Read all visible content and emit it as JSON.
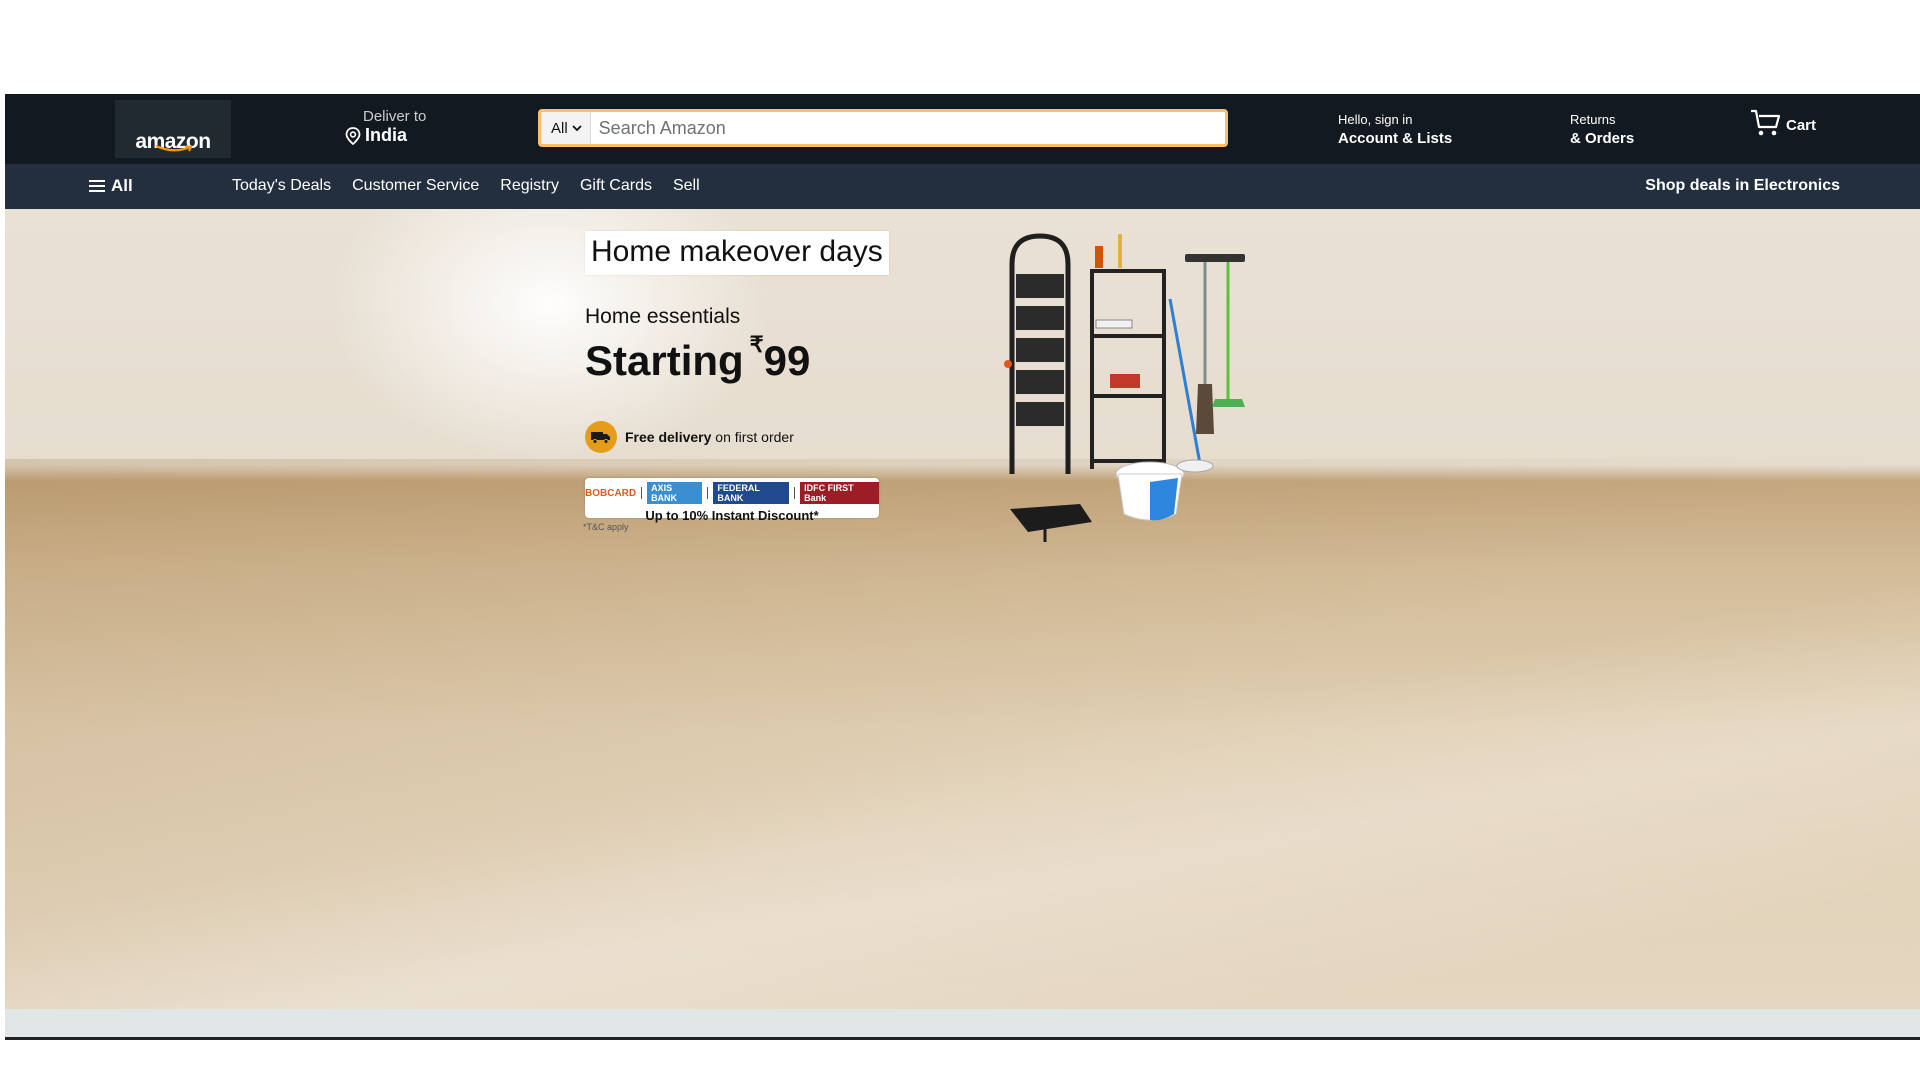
{
  "navbar": {
    "logo_text": "amazon",
    "deliver_label": "Deliver to",
    "deliver_location": "India",
    "search": {
      "category": "All",
      "placeholder": "Search Amazon"
    },
    "account_greeting": "Hello, sign in",
    "account_label": "Account & Lists",
    "returns_label": "Returns",
    "orders_label": "& Orders",
    "cart_label": "Cart"
  },
  "subnav": {
    "all_label": "All",
    "links": [
      "Today's Deals",
      "Customer Service",
      "Registry",
      "Gift Cards",
      "Sell"
    ],
    "promo": "Shop deals in Electronics"
  },
  "hero": {
    "badge": "Home makeover days",
    "subtitle": "Home essentials",
    "price_prefix": "Starting",
    "currency": "₹",
    "price": "99",
    "delivery_bold": "Free delivery",
    "delivery_rest": " on first order",
    "banks": [
      "BOBCARD",
      "AXIS BANK",
      "FEDERAL BANK",
      "IDFC FIRST Bank"
    ],
    "discount": "Up to 10% Instant Discount*",
    "terms": "*T&C apply"
  },
  "colors": {
    "navbar_bg": "#131921",
    "subnav_bg": "#232f3e",
    "search_border": "#febd69",
    "delivery_icon": "#e59c1a"
  },
  "icons": [
    "location-pin-icon",
    "chevron-down-icon",
    "cart-icon",
    "hamburger-menu-icon",
    "delivery-truck-icon"
  ]
}
